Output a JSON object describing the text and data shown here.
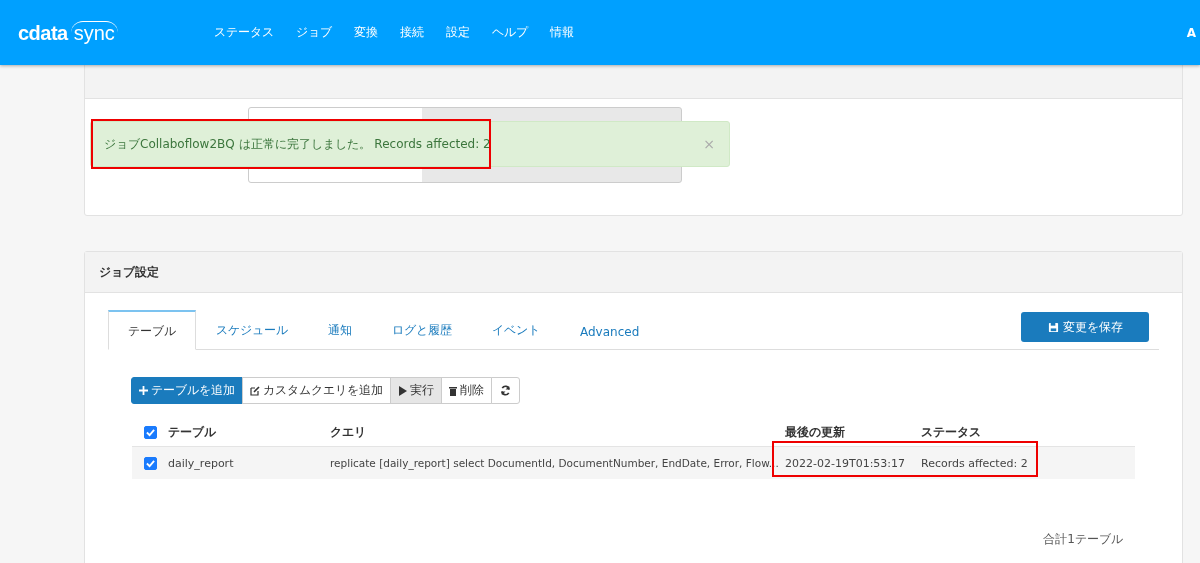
{
  "navbar": {
    "logo_left": "cdata",
    "logo_right": "sync",
    "items": [
      "ステータス",
      "ジョブ",
      "変換",
      "接続",
      "設定",
      "ヘルプ",
      "情報"
    ],
    "user": "A"
  },
  "alert": {
    "message": "ジョブCollaboflow2BQ は正常に完了しました。 Records affected: 2",
    "close": "×"
  },
  "job_panel": {
    "title": "ジョブ設定",
    "tabs": [
      {
        "label": "テーブル",
        "selected": true
      },
      {
        "label": "スケジュール",
        "selected": false
      },
      {
        "label": "通知",
        "selected": false
      },
      {
        "label": "ログと履歴",
        "selected": false
      },
      {
        "label": "イベント",
        "selected": false
      },
      {
        "label": "Advanced",
        "selected": false
      }
    ],
    "save_button": "変更を保存",
    "toolbar": [
      {
        "label": "テーブルを追加",
        "kind": "add"
      },
      {
        "label": "カスタムクエリを追加",
        "kind": "edit"
      },
      {
        "label": "実行",
        "kind": "run"
      },
      {
        "label": "削除",
        "kind": "delete"
      },
      {
        "kind": "refresh"
      }
    ],
    "table": {
      "all_checked": true,
      "columns": [
        "テーブル",
        "クエリ",
        "最後の更新",
        "ステータス"
      ],
      "rows": [
        {
          "checked": true,
          "cells": [
            "daily_report",
            "replicate [daily_report] select DocumentId, DocumentNumber, EndDate, Error, Flow...",
            "2022-02-19T01:53:17",
            "Records affected: 2"
          ]
        }
      ]
    },
    "footer": "合計1テーブル"
  }
}
